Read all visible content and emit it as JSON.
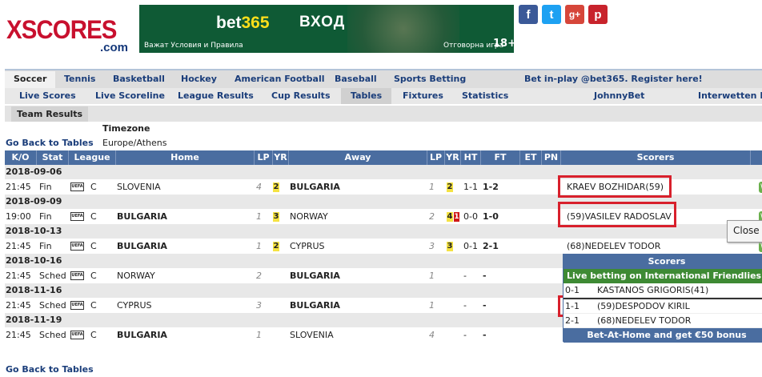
{
  "logo": {
    "main": "XSCORES",
    "domain": ".com"
  },
  "banner": {
    "brand_a": "bet",
    "brand_b": "365",
    "login": "ВХОД",
    "terms": "Важат Условия и Правила",
    "responsible": "Отговорна игра",
    "age": "18+"
  },
  "social": [
    "f",
    "t",
    "g+",
    "p"
  ],
  "sport_nav": [
    "Soccer",
    "Tennis",
    "Basketball",
    "Hockey",
    "American Football",
    "Baseball",
    "Sports Betting",
    "Bet in-play @bet365. Register here!"
  ],
  "sub_nav": [
    "Live Scores",
    "Live Scoreline",
    "League Results",
    "Cup Results",
    "Tables",
    "Fixtures",
    "Statistics",
    "JohnnyBet",
    "Interwetten Li"
  ],
  "team_tab": "Team Results",
  "timezone": {
    "label": "Timezone",
    "value": "Europe/Athens"
  },
  "back_link": "Go Back to Tables",
  "headers": [
    "K/O",
    "Stat",
    "League",
    "Home",
    "LP",
    "YR",
    "Away",
    "LP",
    "YR",
    "HT",
    "FT",
    "ET",
    "PN",
    "Scorers"
  ],
  "matches": [
    {
      "date": "2018-09-06",
      "ko": "21:45",
      "stat": "Fin",
      "league_icon": "UEFA",
      "league": "C",
      "home": "SLOVENIA",
      "home_lp": "4",
      "home_yr": "2",
      "away": "BULGARIA",
      "away_lp": "1",
      "away_yr": "2",
      "away_rc": "",
      "ht": "1-1",
      "ft": "1-2",
      "scorer": "KRAEV BOZHIDAR(59)",
      "badge": "W"
    },
    {
      "date": "2018-09-09",
      "ko": "19:00",
      "stat": "Fin",
      "league_icon": "UEFA",
      "league": "C",
      "home": "BULGARIA",
      "home_lp": "1",
      "home_yr": "3",
      "away": "NORWAY",
      "away_lp": "2",
      "away_yr": "4",
      "away_rc": "1",
      "ht": "0-0",
      "ft": "1-0",
      "scorer": "(59)VASILEV RADOSLAV",
      "badge": "W"
    },
    {
      "date": "2018-10-13",
      "ko": "21:45",
      "stat": "Fin",
      "league_icon": "UEFA",
      "league": "C",
      "home": "BULGARIA",
      "home_lp": "1",
      "home_yr": "2",
      "away": "CYPRUS",
      "away_lp": "3",
      "away_yr": "3",
      "away_rc": "",
      "ht": "0-1",
      "ft": "2-1",
      "scorer": "(68)NEDELEV TODOR",
      "badge": "W"
    },
    {
      "date": "2018-10-16",
      "ko": "21:45",
      "stat": "Sched",
      "league_icon": "UEFA",
      "league": "C",
      "home": "NORWAY",
      "home_lp": "2",
      "home_yr": "",
      "away": "BULGARIA",
      "away_lp": "1",
      "away_yr": "",
      "away_rc": "",
      "ht": "-",
      "ft": "-",
      "scorer": "",
      "badge": ""
    },
    {
      "date": "2018-11-16",
      "ko": "21:45",
      "stat": "Sched",
      "league_icon": "UEFA",
      "league": "C",
      "home": "CYPRUS",
      "home_lp": "3",
      "home_yr": "",
      "away": "BULGARIA",
      "away_lp": "1",
      "away_yr": "",
      "away_rc": "",
      "ht": "-",
      "ft": "-",
      "scorer": "",
      "badge": ""
    },
    {
      "date": "2018-11-19",
      "ko": "21:45",
      "stat": "Sched",
      "league_icon": "UEFA",
      "league": "C",
      "home": "BULGARIA",
      "home_lp": "1",
      "home_yr": "",
      "away": "SLOVENIA",
      "away_lp": "4",
      "away_yr": "",
      "away_rc": "",
      "ht": "-",
      "ft": "-",
      "scorer": "",
      "badge": ""
    }
  ],
  "close_tip": "Close S",
  "popup": {
    "title": "Scorers",
    "live": "Live betting on International Friendlies at b",
    "rows": [
      {
        "score": "0-1",
        "player": "KASTANOS GRIGORIS(41)"
      },
      {
        "score": "1-1",
        "player": "(59)DESPODOV KIRIL"
      },
      {
        "score": "2-1",
        "player": "(68)NEDELEV TODOR"
      }
    ],
    "footer": "Bet-At-Home and get €50 bonus"
  },
  "colors": {
    "header_blue": "#4a6da0",
    "logo_red": "#c8102e",
    "highlight_red": "#d8202c",
    "yellow_card": "#f5e342",
    "live_green": "#3e8a34"
  }
}
